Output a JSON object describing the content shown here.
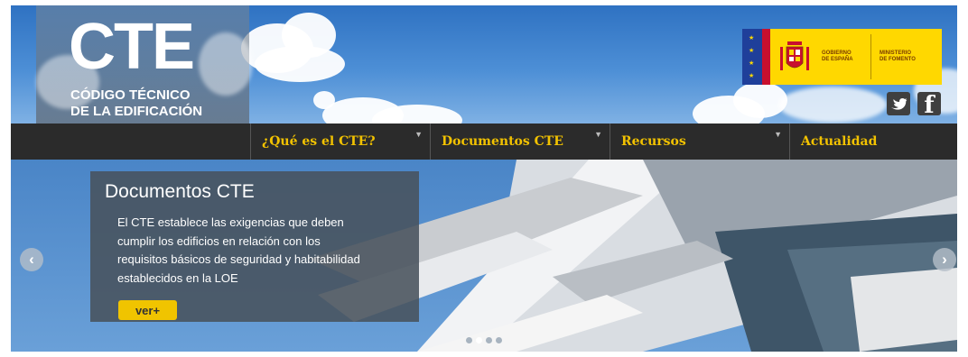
{
  "logo": {
    "mark": "CTE",
    "line1": "CÓDIGO TÉCNICO",
    "line2": "DE LA EDIFICACIÓN"
  },
  "government": {
    "left_label": [
      "GOBIERNO",
      "DE ESPAÑA"
    ],
    "right_label": [
      "MINISTERIO",
      "DE FOMENTO"
    ],
    "colors": {
      "badge": "#ffd800",
      "flag_blue": "#1f3f9a",
      "flag_red": "#c8102e"
    }
  },
  "social": [
    {
      "name": "twitter",
      "icon": "twitter-icon"
    },
    {
      "name": "facebook",
      "icon": "facebook-icon",
      "glyph": "f"
    }
  ],
  "nav": [
    {
      "label": "¿Qué es el CTE?",
      "dropdown": true
    },
    {
      "label": "Documentos CTE",
      "dropdown": true
    },
    {
      "label": "Recursos",
      "dropdown": true
    },
    {
      "label": "Actualidad",
      "dropdown": false
    }
  ],
  "slider": {
    "title": "Documentos CTE",
    "lines": [
      "El CTE establece las exigencias que deben",
      "cumplir los edificios en relación con los",
      "requisitos básicos de seguridad y habitabilidad",
      "establecidos en la LOE"
    ],
    "button": "ver+",
    "prev": "‹",
    "next": "›",
    "slide_count": 4,
    "active_slide": 2
  },
  "colors": {
    "nav_background": "#2b2b2b",
    "nav_text": "#f2c200",
    "accent_button": "#f0c400"
  }
}
